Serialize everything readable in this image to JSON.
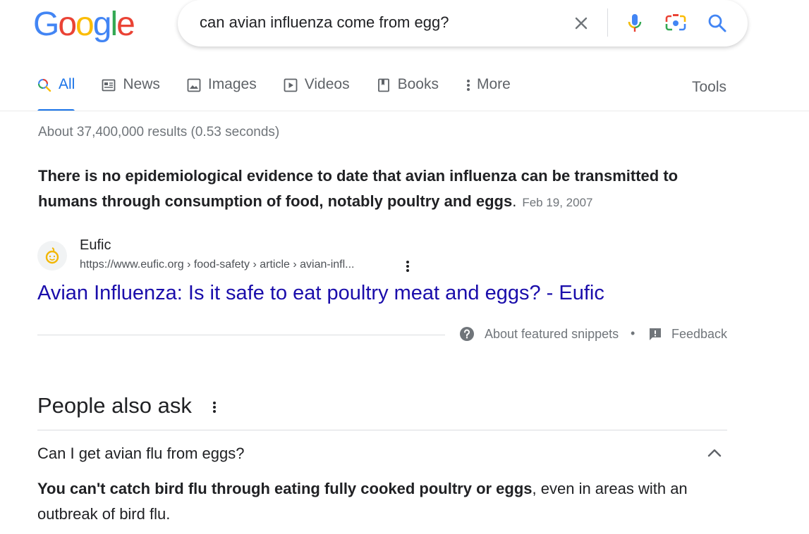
{
  "logo": {
    "letters": [
      {
        "ch": "G",
        "color": "#4285F4"
      },
      {
        "ch": "o",
        "color": "#EA4335"
      },
      {
        "ch": "o",
        "color": "#FBBC05"
      },
      {
        "ch": "g",
        "color": "#4285F4"
      },
      {
        "ch": "l",
        "color": "#34A853"
      },
      {
        "ch": "e",
        "color": "#EA4335"
      }
    ]
  },
  "search": {
    "query": "can avian influenza come from egg?"
  },
  "icons": {
    "clear": "close-icon",
    "voice": "microphone-icon",
    "lens": "camera-lens-icon",
    "search": "search-icon"
  },
  "tabs": [
    {
      "label": "All",
      "icon": "search-icon",
      "active": true
    },
    {
      "label": "News",
      "icon": "news-icon",
      "active": false
    },
    {
      "label": "Images",
      "icon": "image-icon",
      "active": false
    },
    {
      "label": "Videos",
      "icon": "video-icon",
      "active": false
    },
    {
      "label": "Books",
      "icon": "book-icon",
      "active": false
    },
    {
      "label": "More",
      "icon": "more-vert-icon",
      "active": false
    }
  ],
  "tools_label": "Tools",
  "result_stats": "About 37,400,000 results (0.53 seconds)",
  "featured_snippet": {
    "bold_text": "There is no epidemiological evidence to date that avian influenza can be transmitted to humans through consumption of food, notably poultry and eggs",
    "tail_text": ".",
    "date": "Feb 19, 2007",
    "site_name": "Eufic",
    "site_url": "https://www.eufic.org › food-safety › article › avian-infl...",
    "link_title": "Avian Influenza: Is it safe to eat poultry meat and eggs? - Eufic",
    "about_label": "About featured snippets",
    "separator": "•",
    "feedback_label": "Feedback"
  },
  "people_also_ask": {
    "title": "People also ask",
    "question": "Can I get avian flu from eggs?",
    "answer_bold": "You can't catch bird flu through eating fully cooked poultry or eggs",
    "answer_rest": ", even in areas with an outbreak of bird flu."
  },
  "colors": {
    "link": "#1a0dab",
    "active_tab": "#1a73e8",
    "muted": "#70757a"
  }
}
